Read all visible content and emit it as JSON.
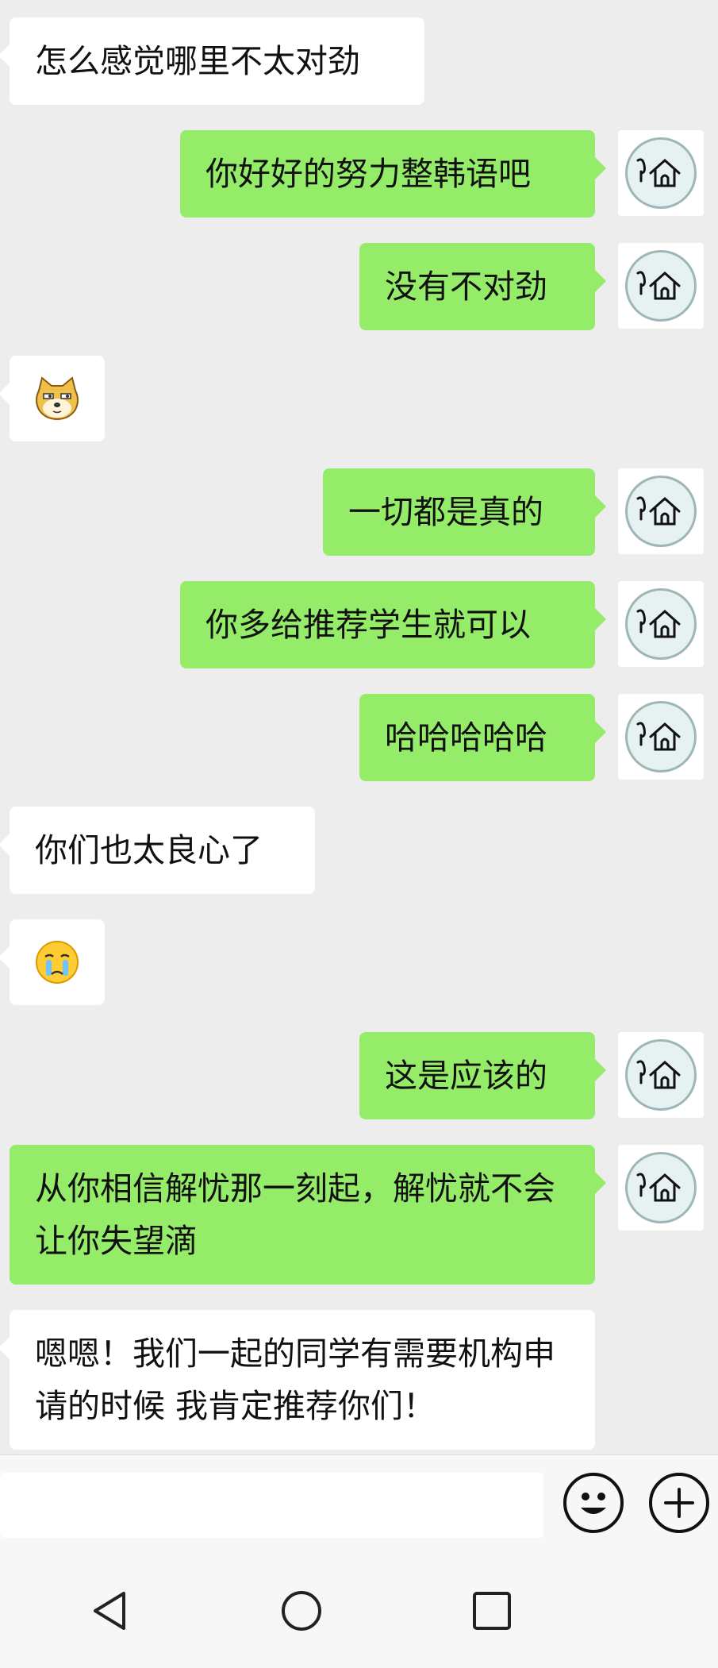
{
  "messages": [
    {
      "side": "in",
      "type": "text",
      "text": "怎么感觉哪里不太对劲"
    },
    {
      "side": "out",
      "type": "text",
      "text": "你好好的努力整韩语吧"
    },
    {
      "side": "out",
      "type": "text",
      "text": "没有不对劲"
    },
    {
      "side": "in",
      "type": "sticker",
      "icon": "doge-face-icon"
    },
    {
      "side": "out",
      "type": "text",
      "text": "一切都是真的"
    },
    {
      "side": "out",
      "type": "text",
      "text": "你多给推荐学生就可以"
    },
    {
      "side": "out",
      "type": "text",
      "text": "哈哈哈哈哈"
    },
    {
      "side": "in",
      "type": "text",
      "text": "你们也太良心了"
    },
    {
      "side": "in",
      "type": "sticker",
      "icon": "crying-face-icon"
    },
    {
      "side": "out",
      "type": "text",
      "text": "这是应该的"
    },
    {
      "side": "out",
      "type": "text",
      "text": "从你相信解忧那一刻起，解忧就不会让你失望滴"
    },
    {
      "side": "in",
      "type": "text",
      "text": "嗯嗯！我们一起的同学有需要机构申请的时候 我肯定推荐你们！"
    }
  ],
  "avatar": {
    "icon": "house-snail-icon"
  },
  "input_bar": {
    "placeholder": "",
    "emoji_button": "smiley-icon",
    "more_button": "plus-circle-icon"
  },
  "navbar": {
    "back": "triangle-back-icon",
    "home": "circle-home-icon",
    "recents": "square-recents-icon"
  },
  "colors": {
    "background": "#ededed",
    "outgoing_bubble": "#95ec69",
    "incoming_bubble": "#ffffff"
  }
}
